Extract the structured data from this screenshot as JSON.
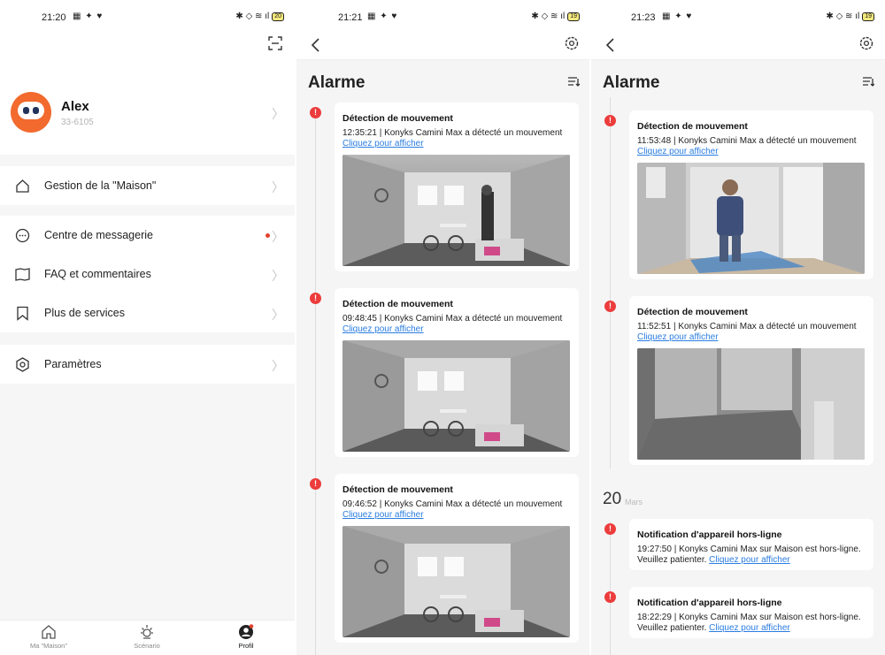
{
  "status": {
    "p1": {
      "time": "21:20",
      "battery": "20"
    },
    "p2": {
      "time": "21:21",
      "battery": "19"
    },
    "p3": {
      "time": "21:23",
      "battery": "19"
    }
  },
  "profile": {
    "name": "Alex",
    "id": "33-6105",
    "menu": [
      {
        "label": "Gestion de la \"Maison\""
      },
      {
        "label": "Centre de messagerie"
      },
      {
        "label": "FAQ et commentaires"
      },
      {
        "label": "Plus de services"
      },
      {
        "label": "Paramètres"
      }
    ],
    "tabs": [
      {
        "label": "Ma \"Maison\""
      },
      {
        "label": "Scénario"
      },
      {
        "label": "Profil"
      }
    ]
  },
  "alarm_title": "Alarme",
  "alarm_left": {
    "events": [
      {
        "title": "Détection de mouvement",
        "desc": "12:35:21 | Konyks Camini Max a détecté un mouvement",
        "link": "Cliquez pour afficher"
      },
      {
        "title": "Détection de mouvement",
        "desc": "09:48:45 | Konyks Camini Max a détecté un mouvement",
        "link": "Cliquez pour afficher"
      },
      {
        "title": "Détection de mouvement",
        "desc": "09:46:52 | Konyks Camini Max a détecté un mouvement",
        "link": "Cliquez pour afficher"
      }
    ]
  },
  "alarm_right": {
    "events": [
      {
        "title": "Détection de mouvement",
        "desc": "11:53:48 | Konyks Camini Max a détecté un mouvement",
        "link": "Cliquez pour afficher"
      },
      {
        "title": "Détection de mouvement",
        "desc": "11:52:51 | Konyks Camini Max a détecté un mouvement",
        "link": "Cliquez pour afficher"
      }
    ],
    "date_day": "20",
    "date_month": "Mars",
    "offline": [
      {
        "title": "Notification d'appareil hors-ligne",
        "desc": "19:27:50 | Konyks Camini Max sur Maison est hors-ligne.",
        "desc2": "Veuillez patienter.",
        "link": "Cliquez pour afficher"
      },
      {
        "title": "Notification d'appareil hors-ligne",
        "desc": "18:22:29 | Konyks Camini Max sur Maison est hors-ligne.",
        "desc2": "Veuillez patienter.",
        "link": "Cliquez pour afficher"
      }
    ]
  },
  "alert_mark": "!",
  "colors": {
    "accent": "#f26a2e",
    "alert": "#ec3c3c",
    "link": "#2a7de1"
  },
  "icons": [
    "scan-icon",
    "home-icon",
    "chat-icon",
    "book-icon",
    "bookmark-icon",
    "settings-icon",
    "scenario-icon",
    "profile-icon",
    "back-icon",
    "gear-icon",
    "filter-icon"
  ]
}
